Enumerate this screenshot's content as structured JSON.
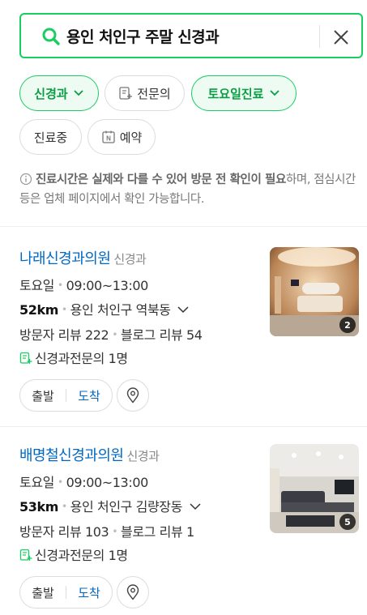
{
  "search": {
    "query": "용인 처인구 주말 신경과"
  },
  "filters": [
    {
      "label": "신경과",
      "active": true,
      "dropdown": true
    },
    {
      "label": "전문의",
      "active": false,
      "icon": "specialist-doc-icon"
    },
    {
      "label": "토요일진료",
      "active": true,
      "dropdown": true
    },
    {
      "label": "진료중",
      "active": false
    },
    {
      "label": "예약",
      "active": false,
      "icon": "naver-booking-icon"
    }
  ],
  "notice": {
    "bold": "진료시간은 실제와 다를 수 있어 방문 전 확인이 필요",
    "rest": "하며, 점심시간 등은 업체 페이지에서 확인 가능합니다."
  },
  "results": [
    {
      "name": "나래신경과의원",
      "category": "신경과",
      "day": "토요일",
      "hours": "09:00~13:00",
      "distance": "52km",
      "address": "용인 처인구 역북동",
      "visitor_reviews": "방문자 리뷰 222",
      "blog_reviews": "블로그 리뷰 54",
      "specialist": "신경과전문의 1명",
      "photo_count": "2",
      "depart_label": "출발",
      "arrive_label": "도착"
    },
    {
      "name": "배명철신경과의원",
      "category": "신경과",
      "day": "토요일",
      "hours": "09:00~13:00",
      "distance": "53km",
      "address": "용인 처인구 김량장동",
      "visitor_reviews": "방문자 리뷰 103",
      "blog_reviews": "블로그 리뷰 1",
      "specialist": "신경과전문의 1명",
      "photo_count": "5",
      "depart_label": "출발",
      "arrive_label": "도착"
    }
  ],
  "colors": {
    "accent_green": "#19ce60",
    "link_blue": "#0068c3"
  }
}
